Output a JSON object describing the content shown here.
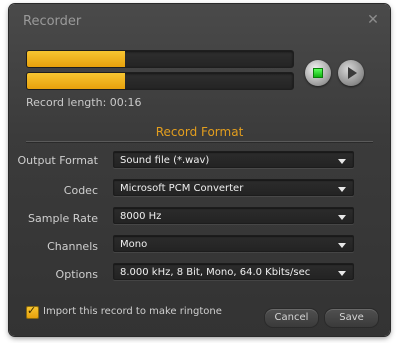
{
  "window": {
    "title": "Recorder"
  },
  "record": {
    "level_1_fraction": 0.37,
    "level_2_fraction": 0.37,
    "length_text": "Record length: 00:16"
  },
  "section": {
    "title": "Record Format"
  },
  "fields": [
    {
      "label": "Output Format",
      "value": "Sound file (*.wav)"
    },
    {
      "label": "Codec",
      "value": "Microsoft PCM Converter"
    },
    {
      "label": "Sample Rate",
      "value": "8000 Hz"
    },
    {
      "label": "Channels",
      "value": "Mono"
    },
    {
      "label": "Options",
      "value": "8.000 kHz, 8 Bit, Mono, 64.0 Kbits/sec"
    }
  ],
  "import_checkbox": {
    "label": "Import this record to make ringtone",
    "checked": true
  },
  "buttons": {
    "cancel": "Cancel",
    "save": "Save"
  },
  "colors": {
    "accent": "#f0b020",
    "background": "#3b3b3b",
    "stop_button": "#22cc22"
  },
  "icons": {
    "close": "close-icon",
    "stop": "stop-icon",
    "play": "play-icon",
    "dropdown": "chevron-down-icon",
    "check": "check-icon"
  }
}
